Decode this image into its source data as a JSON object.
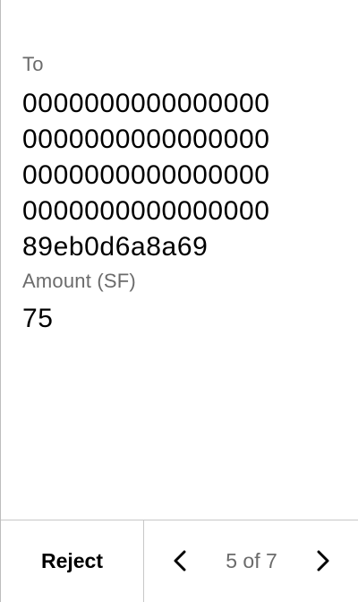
{
  "to": {
    "label": "To",
    "address_lines": [
      "0000000000000000",
      "0000000000000000",
      "0000000000000000",
      "0000000000000000",
      "89eb0d6a8a69"
    ]
  },
  "amount": {
    "label": "Amount (SF)",
    "value": "75"
  },
  "footer": {
    "reject_label": "Reject",
    "pager_text": "5 of 7",
    "prev_icon": "chevron-left-icon",
    "next_icon": "chevron-right-icon"
  },
  "colors": {
    "label_gray": "#6b6b6b",
    "divider": "#c8c8c8"
  }
}
